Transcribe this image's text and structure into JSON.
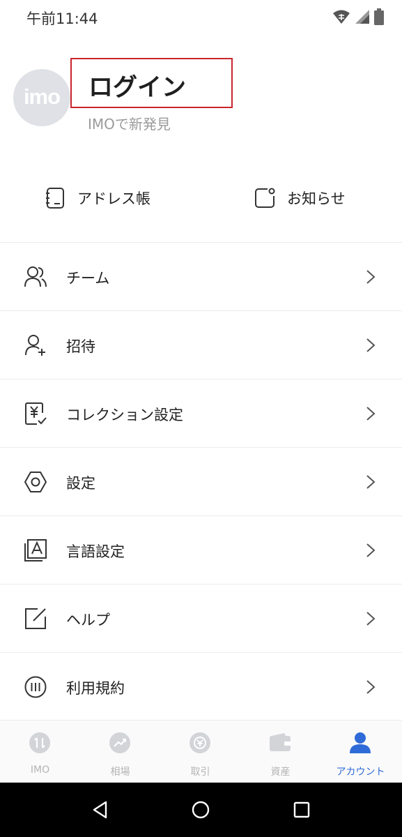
{
  "status": {
    "time": "午前11:44"
  },
  "profile": {
    "avatar_text": "imo",
    "login_title": "ログイン",
    "subtitle": "IMOで新発見"
  },
  "quick": {
    "address_book": "アドレス帳",
    "notices": "お知らせ"
  },
  "menu": {
    "items": [
      {
        "label": "チーム",
        "icon": "team-icon"
      },
      {
        "label": "招待",
        "icon": "invite-icon"
      },
      {
        "label": "コレクション設定",
        "icon": "collection-icon"
      },
      {
        "label": "設定",
        "icon": "settings-icon"
      },
      {
        "label": "言語設定",
        "icon": "language-icon"
      },
      {
        "label": "ヘルプ",
        "icon": "help-icon"
      },
      {
        "label": "利用規約",
        "icon": "terms-icon"
      }
    ]
  },
  "tabs": {
    "items": [
      {
        "label": "IMO",
        "icon": "imo-icon"
      },
      {
        "label": "相場",
        "icon": "market-icon"
      },
      {
        "label": "取引",
        "icon": "trade-icon"
      },
      {
        "label": "資産",
        "icon": "wallet-icon"
      },
      {
        "label": "アカウント",
        "icon": "account-icon"
      }
    ],
    "active": "アカウント"
  },
  "colors": {
    "accent": "#2f6bd8",
    "highlight_border": "#c9252c",
    "muted_text": "#9a9a9a",
    "divider": "#ececec"
  }
}
